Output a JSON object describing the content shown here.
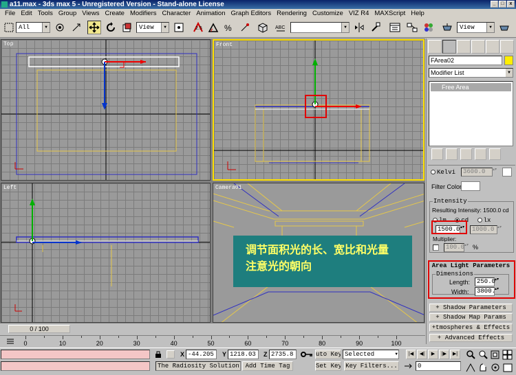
{
  "window": {
    "title": "a11.max - 3ds max 5 - Unregistered Version - Stand-alone License",
    "buttons": [
      "_",
      "□",
      "x"
    ]
  },
  "menu": [
    "File",
    "Edit",
    "Tools",
    "Group",
    "Views",
    "Create",
    "Modifiers",
    "Character",
    "Animation",
    "Graph Editors",
    "Rendering",
    "Customize",
    "VIZ R4",
    "MAXScript",
    "Help"
  ],
  "toolbar": {
    "selection_filter": "All",
    "reference_coord": "View",
    "named_selection": "",
    "render_view": "View"
  },
  "viewports": {
    "top": {
      "label": "Top"
    },
    "front": {
      "label": "Front"
    },
    "left": {
      "label": "Left"
    },
    "camera": {
      "label": "Camera01"
    }
  },
  "callout": {
    "line1": "调节面积光的长、宽比和光量",
    "line2": "注意光的朝向"
  },
  "command_panel": {
    "object_name": "FArea02",
    "modifier_list": "Modifier List",
    "stack_item": "Free Area",
    "kelvin_label": "Kelvi",
    "kelvin_value": "3600.0",
    "filter_color_label": "Filter Color:",
    "intensity_title": "Intensity",
    "resulting_intensity": "Resulting Intensity: 1500.0 cd",
    "unit_lm": "lm",
    "unit_cd": "cd",
    "unit_lx": "lx",
    "intensity_value": "1500.0",
    "intensity_value2": "1000.0",
    "multiplier_label": "Multiplier:",
    "multiplier_value": "100.0",
    "percent": "%",
    "area_params_title": "Area Light Parameters",
    "dimensions_title": "Dimensions",
    "length_label": "Length:",
    "length_value": "250.0",
    "width_label": "Width:",
    "width_value": "3800.",
    "rollout_shadow_params": "+ Shadow Parameters",
    "rollout_shadow_map": "+ Shadow Map Params",
    "rollout_atmospheres": "+tmospheres & Effects",
    "rollout_advanced": "+ Advanced Effects"
  },
  "timeline": {
    "frame": "0 / 100",
    "ticks": [
      "0",
      "10",
      "20",
      "30",
      "40",
      "50",
      "60",
      "70",
      "80",
      "90",
      "100"
    ]
  },
  "status": {
    "x_label": "X",
    "x_value": "-44.205",
    "y_label": "Y",
    "y_value": "1218.03",
    "z_label": "Z",
    "z_value": "2735.8",
    "auto_key": "uto Key",
    "set_key": "Set Key",
    "key_mode": "Selected",
    "key_filters": "Key Filters...",
    "prompt": "The Radiosity Solution",
    "add_time_tag": "Add Time Tag",
    "current_frame": "0"
  },
  "colors": {
    "active_viewport": "#ffe000",
    "highlight": "#e00000",
    "callout_bg": "#1e7e7e",
    "callout_text": "#ffff66"
  }
}
